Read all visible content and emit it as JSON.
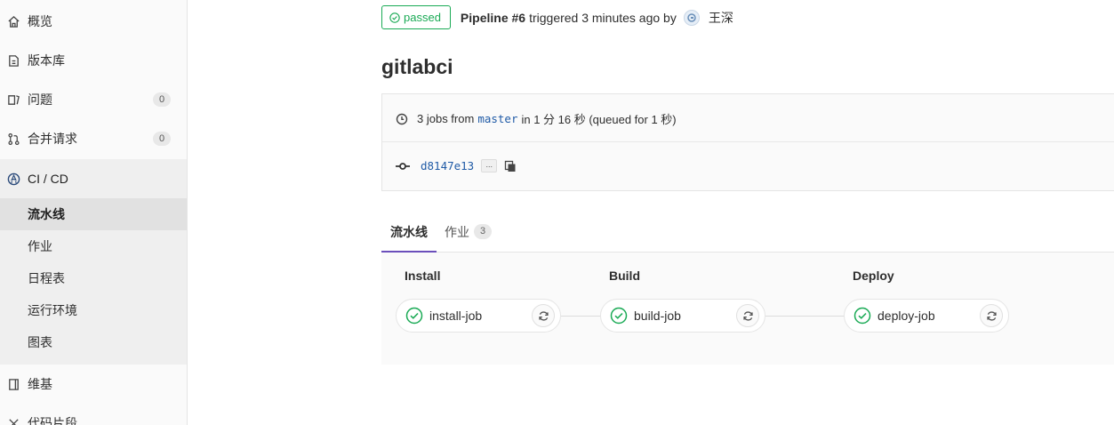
{
  "sidebar": {
    "items": [
      {
        "label": "概览",
        "icon": "home-icon"
      },
      {
        "label": "版本库",
        "icon": "document-icon"
      },
      {
        "label": "问题",
        "icon": "issues-icon",
        "badge": "0"
      },
      {
        "label": "合并请求",
        "icon": "merge-request-icon",
        "badge": "0"
      },
      {
        "label": "CI / CD",
        "icon": "rocket-icon"
      },
      {
        "label": "维基",
        "icon": "book-icon"
      },
      {
        "label": "代码片段",
        "icon": "snippet-icon"
      }
    ],
    "cicd_subitems": [
      {
        "label": "流水线",
        "active": true
      },
      {
        "label": "作业"
      },
      {
        "label": "日程表"
      },
      {
        "label": "运行环境"
      },
      {
        "label": "图表"
      }
    ]
  },
  "header": {
    "status": "passed",
    "pipeline_label": "Pipeline #6",
    "triggered_text": "triggered 3 minutes ago by",
    "user_name": "王深"
  },
  "page_title": "gitlabci",
  "info": {
    "jobs_text": "3 jobs from",
    "branch": "master",
    "duration_text": "in 1 分 16 秒 (queued for 1 秒)",
    "commit_sha": "d8147e13",
    "ellipsis": "..."
  },
  "tabs": [
    {
      "label": "流水线",
      "active": true
    },
    {
      "label": "作业",
      "count": "3"
    }
  ],
  "stages": [
    {
      "name": "Install",
      "job": "install-job",
      "status": "success"
    },
    {
      "name": "Build",
      "job": "build-job",
      "status": "success"
    },
    {
      "name": "Deploy",
      "job": "deploy-job",
      "status": "success"
    }
  ],
  "colors": {
    "success": "#1aaa55",
    "link": "#1f5aa6",
    "tab_active": "#6b4fbb"
  }
}
